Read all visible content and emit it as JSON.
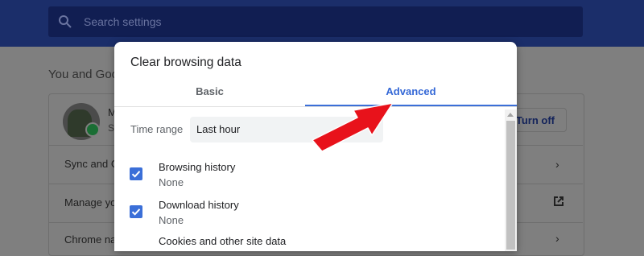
{
  "settings_page": {
    "search": {
      "placeholder": "Search settings"
    },
    "section_title": "You and Goo",
    "profile": {
      "name_peek": "M",
      "status_peek": "S"
    },
    "turn_off_label": "Turn off",
    "rows": [
      {
        "label": "Sync and G"
      },
      {
        "label": "Manage yo"
      },
      {
        "label": "Chrome na"
      }
    ]
  },
  "dialog": {
    "title": "Clear browsing data",
    "tabs": [
      {
        "label": "Basic",
        "selected": false
      },
      {
        "label": "Advanced",
        "selected": true
      }
    ],
    "time_range": {
      "label": "Time range",
      "value": "Last hour"
    },
    "items": [
      {
        "title": "Browsing history",
        "subtitle": "None",
        "checked": true
      },
      {
        "title": "Download history",
        "subtitle": "None",
        "checked": true
      },
      {
        "title": "Cookies and other site data",
        "checked": true
      }
    ]
  },
  "colors": {
    "accent": "#3b6fd8",
    "header_bg": "#1b2e6a",
    "overlay_gray": "#7f7f7f",
    "annotation_arrow": "#e8121b"
  },
  "icons": {
    "search": "search-icon",
    "chevron": "chevron-right-icon",
    "external": "open-in-new-icon",
    "checkbox": "checkmark-icon",
    "annotation": "red-arrow-icon"
  }
}
